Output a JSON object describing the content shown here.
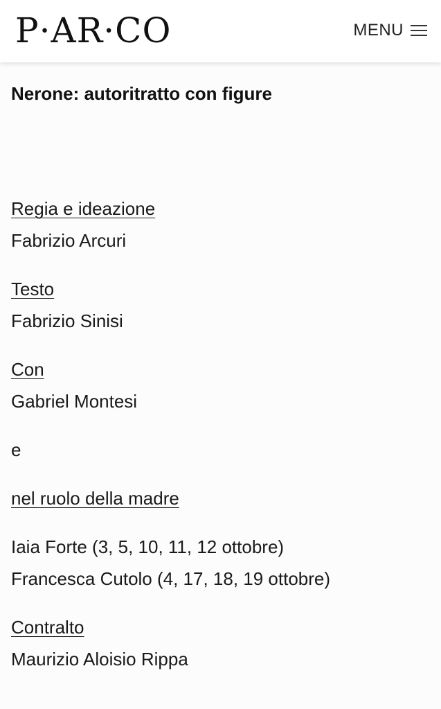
{
  "header": {
    "logo_text": "P·AR·CO",
    "menu_label": "MENU",
    "menu_icon": "hamburger-icon"
  },
  "show": {
    "title": "Nerone: autoritratto con figure"
  },
  "credits": [
    {
      "role": "Regia e ideazione",
      "names": [
        "Fabrizio Arcuri"
      ]
    },
    {
      "role": "Testo",
      "names": [
        "Fabrizio Sinisi"
      ]
    },
    {
      "role": "Con",
      "names": [
        "Gabriel Montesi"
      ]
    }
  ],
  "connector": "e",
  "mother_role": {
    "role": "nel ruolo della madre",
    "names": [
      "Iaia Forte (3, 5, 10, 11, 12 ottobre)",
      "Francesca Cutolo (4, 17, 18, 19 ottobre)"
    ]
  },
  "contralto": {
    "role": "Contralto",
    "names": [
      "Maurizio Aloisio Rippa"
    ]
  },
  "colors": {
    "background": "#fcfcfc",
    "text": "#1a1a1a",
    "header_bg": "#ffffff"
  }
}
